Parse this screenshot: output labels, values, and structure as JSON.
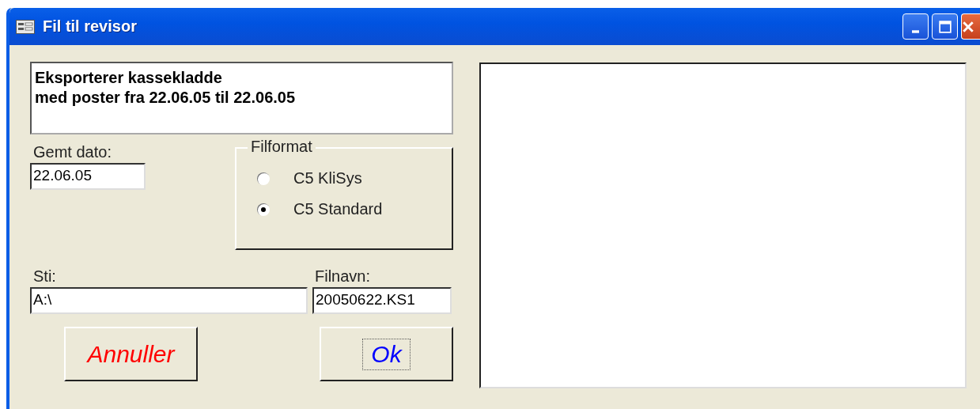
{
  "window": {
    "title": "Fil til revisor"
  },
  "message": {
    "lines": [
      "Eksporterer kassekladde",
      "med poster fra 22.06.05 til 22.06.05"
    ]
  },
  "saved_date": {
    "label": "Gemt dato:",
    "value": "22.06.05"
  },
  "file_format": {
    "legend": "Filformat",
    "options": [
      {
        "label": "C5 KliSys",
        "selected": false
      },
      {
        "label": "C5 Standard",
        "selected": true
      }
    ]
  },
  "path": {
    "label": "Sti:",
    "value": "A:\\"
  },
  "filename": {
    "label": "Filnavn:",
    "value": "20050622.KS1"
  },
  "buttons": [
    {
      "label": "Annuller",
      "kind": "cancel",
      "focused": false
    },
    {
      "label": "Ok",
      "kind": "ok",
      "focused": true
    }
  ]
}
